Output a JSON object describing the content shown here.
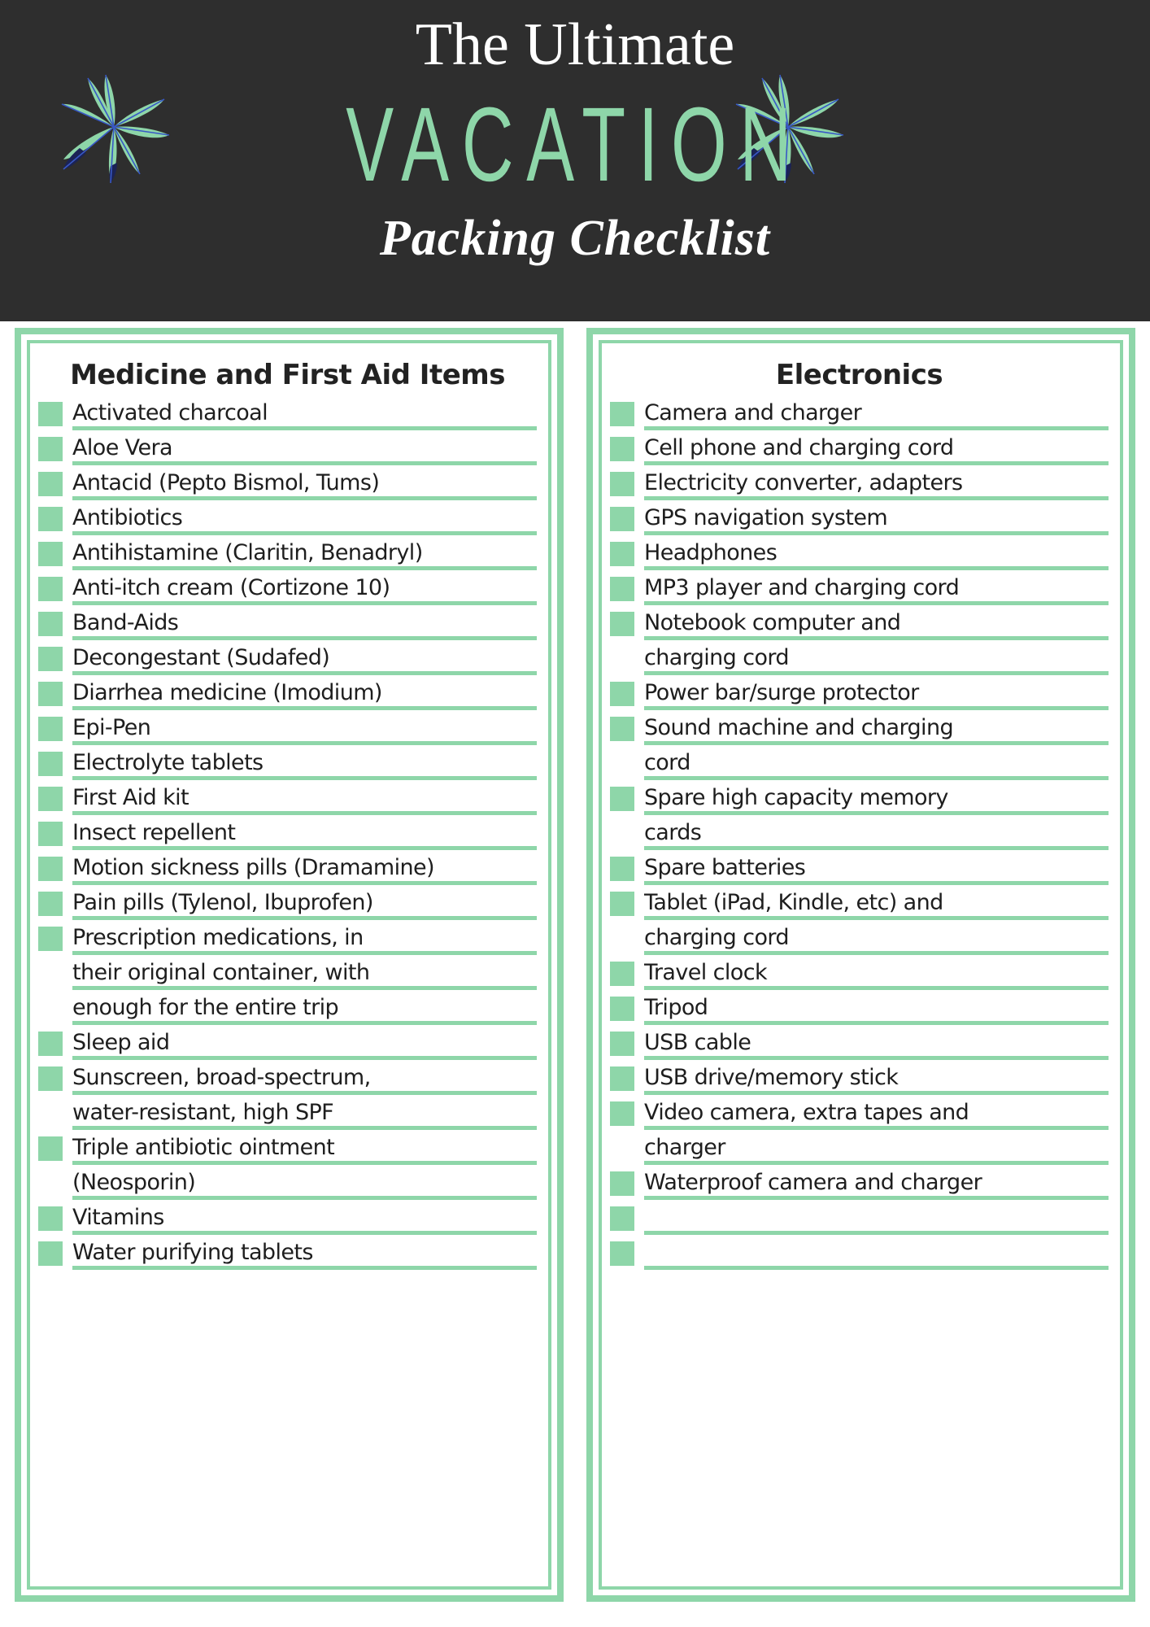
{
  "header": {
    "line1": "The Ultimate",
    "line2": "VACATION",
    "line3": "Packing Checklist",
    "background_color": "#2e2e2e",
    "accent_color": "#8ed6a9",
    "leaf_colors": {
      "leaf": "#8ed6a9",
      "tip": "#1b2356",
      "vein": "#3858c6"
    }
  },
  "columns": [
    {
      "title": "Medicine and First Aid Items",
      "items": [
        {
          "text": "Activated charcoal",
          "checkbox": true
        },
        {
          "text": "Aloe Vera",
          "checkbox": true
        },
        {
          "text": "Antacid (Pepto Bismol, Tums)",
          "checkbox": true
        },
        {
          "text": "Antibiotics",
          "checkbox": true
        },
        {
          "text": "Antihistamine (Claritin, Benadryl)",
          "checkbox": true
        },
        {
          "text": "Anti-itch cream (Cortizone 10)",
          "checkbox": true
        },
        {
          "text": "Band-Aids",
          "checkbox": true
        },
        {
          "text": "Decongestant (Sudafed)",
          "checkbox": true
        },
        {
          "text": "Diarrhea medicine (Imodium)",
          "checkbox": true
        },
        {
          "text": "Epi-Pen",
          "checkbox": true
        },
        {
          "text": "Electrolyte tablets",
          "checkbox": true
        },
        {
          "text": "First Aid kit",
          "checkbox": true
        },
        {
          "text": "Insect repellent",
          "checkbox": true
        },
        {
          "text": "Motion sickness pills (Dramamine)",
          "checkbox": true
        },
        {
          "text": "Pain pills (Tylenol, Ibuprofen)",
          "checkbox": true
        },
        {
          "text": "Prescription medications, in",
          "checkbox": true
        },
        {
          "text": "their original container, with",
          "checkbox": false
        },
        {
          "text": "enough for the entire trip",
          "checkbox": false
        },
        {
          "text": "Sleep aid",
          "checkbox": true
        },
        {
          "text": "Sunscreen, broad-spectrum,",
          "checkbox": true
        },
        {
          "text": "water-resistant, high SPF",
          "checkbox": false
        },
        {
          "text": "Triple antibiotic ointment",
          "checkbox": true
        },
        {
          "text": "(Neosporin)",
          "checkbox": false
        },
        {
          "text": "Vitamins",
          "checkbox": true
        },
        {
          "text": "Water purifying tablets",
          "checkbox": true
        }
      ]
    },
    {
      "title": "Electronics",
      "items": [
        {
          "text": "Camera and charger",
          "checkbox": true
        },
        {
          "text": "Cell phone and charging cord",
          "checkbox": true
        },
        {
          "text": "Electricity converter, adapters",
          "checkbox": true
        },
        {
          "text": "GPS navigation system",
          "checkbox": true
        },
        {
          "text": "Headphones",
          "checkbox": true
        },
        {
          "text": "MP3 player and charging cord",
          "checkbox": true
        },
        {
          "text": "Notebook computer and",
          "checkbox": true
        },
        {
          "text": "charging cord",
          "checkbox": false
        },
        {
          "text": "Power bar/surge protector",
          "checkbox": true
        },
        {
          "text": "Sound machine and charging",
          "checkbox": true
        },
        {
          "text": "cord",
          "checkbox": false
        },
        {
          "text": "Spare high capacity memory",
          "checkbox": true
        },
        {
          "text": "cards",
          "checkbox": false
        },
        {
          "text": "Spare batteries",
          "checkbox": true
        },
        {
          "text": "Tablet (iPad, Kindle, etc) and",
          "checkbox": true
        },
        {
          "text": "charging cord",
          "checkbox": false
        },
        {
          "text": "Travel clock",
          "checkbox": true
        },
        {
          "text": "Tripod",
          "checkbox": true
        },
        {
          "text": "USB cable",
          "checkbox": true
        },
        {
          "text": "USB drive/memory stick",
          "checkbox": true
        },
        {
          "text": "Video camera, extra tapes and",
          "checkbox": true
        },
        {
          "text": "charger",
          "checkbox": false
        },
        {
          "text": "Waterproof camera and charger",
          "checkbox": true
        },
        {
          "text": "",
          "checkbox": true
        },
        {
          "text": "",
          "checkbox": true
        }
      ]
    }
  ]
}
